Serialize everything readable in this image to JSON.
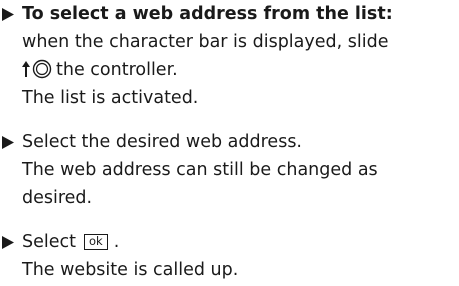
{
  "steps": [
    {
      "heading": "To select a web address from the list:",
      "line2": "when the character bar is displayed, slide",
      "line3_text": "the controller.",
      "line4": "The list is activated."
    },
    {
      "line1": "Select the desired web address.",
      "line2": "The web address can still be changed as",
      "line3": "desired."
    },
    {
      "select_prefix": "Select",
      "ok_label": "ok",
      "select_suffix": ".",
      "line2": "The website is called up."
    }
  ],
  "icons": {
    "bullet": "triangle-right-icon",
    "controller": "controller-slide-up-icon"
  }
}
